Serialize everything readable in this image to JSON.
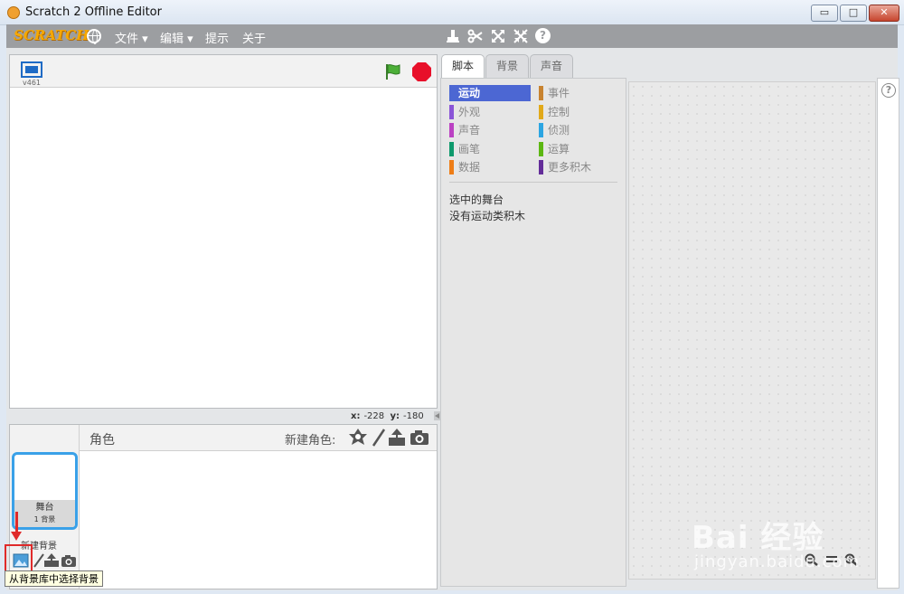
{
  "window": {
    "title": "Scratch 2 Offline Editor",
    "minimize": "▭",
    "maximize": "□",
    "close": "✕"
  },
  "menubar": {
    "logo": "SCRATCH",
    "items": [
      {
        "label": "文件 ▾"
      },
      {
        "label": "编辑 ▾"
      },
      {
        "label": "提示"
      },
      {
        "label": "关于"
      }
    ],
    "tools": [
      "duplicate-stamp-icon",
      "delete-cut-icon",
      "grow-icon",
      "shrink-icon",
      "help-icon"
    ]
  },
  "stage": {
    "version": "v461",
    "coords": {
      "x_label": "x:",
      "x_value": "-228",
      "y_label": "y:",
      "y_value": "-180"
    }
  },
  "sprites": {
    "header_label": "角色",
    "new_sprite_label": "新建角色:",
    "stage_thumb": {
      "name": "舞台",
      "sub": "1 背景"
    },
    "new_backdrop_label": "新建背景",
    "tooltip": "从背景库中选择背景"
  },
  "tabs": [
    {
      "label": "脚本",
      "active": true
    },
    {
      "label": "背景",
      "active": false
    },
    {
      "label": "声音",
      "active": false
    }
  ],
  "palette": {
    "categories_left": [
      {
        "label": "运动",
        "color": "#4a6cd4",
        "active": true
      },
      {
        "label": "外观",
        "color": "#8a55d7"
      },
      {
        "label": "声音",
        "color": "#bb42c3"
      },
      {
        "label": "画笔",
        "color": "#0e9a6c"
      },
      {
        "label": "数据",
        "color": "#ee7d16"
      }
    ],
    "categories_right": [
      {
        "label": "事件",
        "color": "#c88330"
      },
      {
        "label": "控制",
        "color": "#e1a91a"
      },
      {
        "label": "侦测",
        "color": "#2ca5e2"
      },
      {
        "label": "运算",
        "color": "#5cb712"
      },
      {
        "label": "更多积木",
        "color": "#632d99"
      }
    ],
    "note_line1": "选中的舞台",
    "note_line2": "没有运动类积木"
  },
  "watermark": {
    "main": "Bai 经验",
    "sub": "jingyan.baidu.com"
  },
  "colors": {
    "accent_blue": "#4c67d3",
    "menubar_gray": "#9c9ea1",
    "selection_blue": "#3aa1e8",
    "annotation_red": "#e02a2a"
  }
}
